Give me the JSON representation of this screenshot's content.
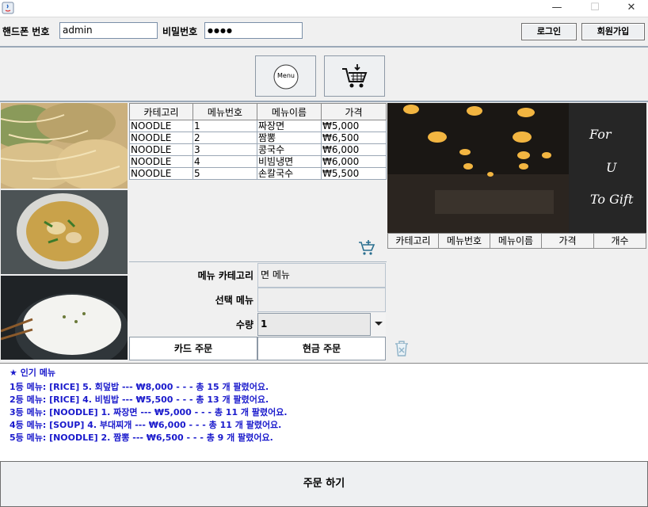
{
  "window": {
    "minimize": "—",
    "maximize": "☐",
    "close": "✕"
  },
  "login": {
    "phone_label": "핸드폰 번호",
    "phone_value": "admin",
    "password_label": "비밀번호",
    "password_value": "●●●●",
    "login_button": "로그인",
    "signup_button": "회원가입"
  },
  "toolbar": {
    "menu_button": "Menu",
    "cart_icon": "cart-download-icon"
  },
  "menu_table": {
    "headers": [
      "카테고리",
      "메뉴번호",
      "메뉴이름",
      "가격"
    ],
    "rows": [
      [
        "NOODLE",
        "1",
        "짜장면",
        "₩5,000"
      ],
      [
        "NOODLE",
        "2",
        "짬뽕",
        "₩6,500"
      ],
      [
        "NOODLE",
        "3",
        "콩국수",
        "₩6,000"
      ],
      [
        "NOODLE",
        "4",
        "비빔냉면",
        "₩6,000"
      ],
      [
        "NOODLE",
        "5",
        "손칼국수",
        "₩5,500"
      ]
    ]
  },
  "cart_table": {
    "headers": [
      "카테고리",
      "메뉴번호",
      "메뉴이름",
      "가격",
      "개수"
    ]
  },
  "banner": {
    "line1": "For",
    "line2": "U",
    "line3": "To Gift"
  },
  "form": {
    "category_label": "메뉴 카테고리",
    "category_value": "면 메뉴",
    "selected_label": "선택 메뉴",
    "selected_value": "",
    "quantity_label": "수량",
    "quantity_value": "1"
  },
  "actions": {
    "card_order": "카드 주문",
    "cash_order": "현금 주문",
    "order_all": "주문 하기"
  },
  "popular": {
    "title": "★ 인기 메뉴",
    "items": [
      "1등 메뉴:  [RICE]  5. 회덮밥 --- ₩8,000 - - - 총 15 개 팔렸어요.",
      "2등 메뉴:  [RICE]  4. 비빔밥 --- ₩5,500 - - - 총 13 개 팔렸어요.",
      "3등 메뉴:  [NOODLE]  1. 짜장면 --- ₩5,000 - - - 총 11 개 팔렸어요.",
      "4등 메뉴:  [SOUP]  4. 부대찌개 --- ₩6,000 - - - 총 11 개 팔렸어요.",
      "5등 메뉴:  [NOODLE]  2. 짬뽕 --- ₩6,500 - - - 총 9 개 팔렸어요."
    ]
  },
  "colors": {
    "accent_text": "#1a1acc",
    "star": "#1a1acc"
  }
}
